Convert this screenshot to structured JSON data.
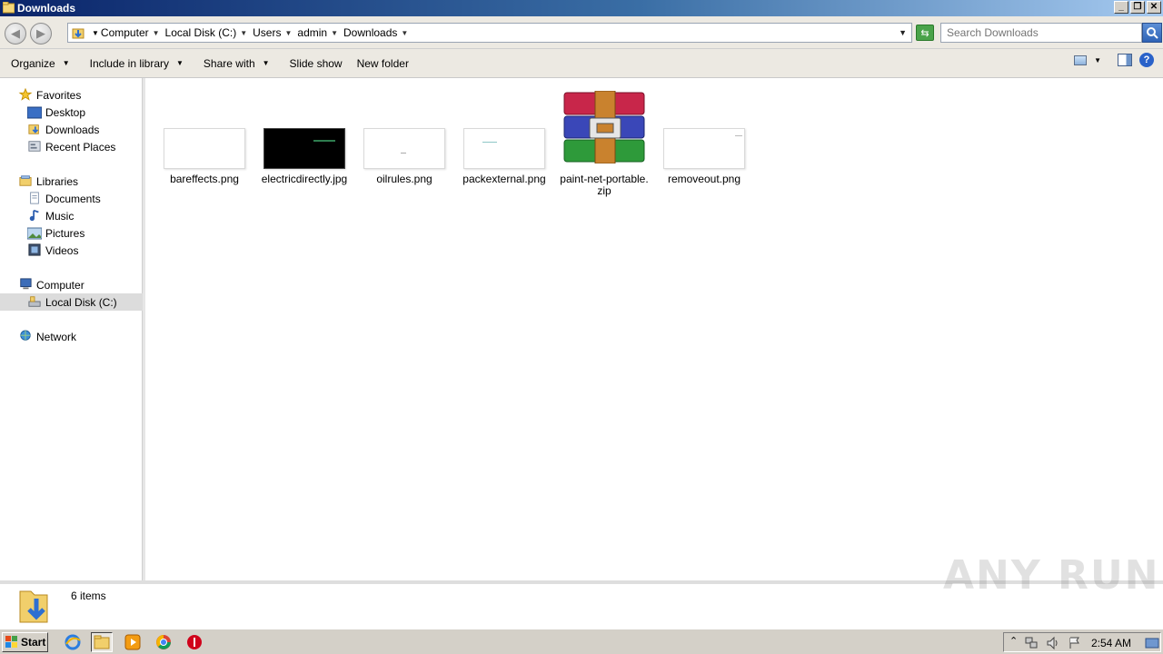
{
  "window": {
    "title": "Downloads"
  },
  "address": {
    "crumbs": [
      "Computer",
      "Local Disk (C:)",
      "Users",
      "admin",
      "Downloads"
    ],
    "search_placeholder": "Search Downloads"
  },
  "toolbar": {
    "organize": "Organize",
    "include_in_library": "Include in library",
    "share_with": "Share with",
    "slide_show": "Slide show",
    "new_folder": "New folder"
  },
  "nav": {
    "favorites": "Favorites",
    "desktop": "Desktop",
    "downloads": "Downloads",
    "recent_places": "Recent Places",
    "libraries": "Libraries",
    "documents": "Documents",
    "music": "Music",
    "pictures": "Pictures",
    "videos": "Videos",
    "computer": "Computer",
    "local_disk": "Local Disk (C:)",
    "network": "Network"
  },
  "files": [
    {
      "name": "bareffects.png",
      "kind": "image",
      "thumb": "#ffffff"
    },
    {
      "name": "electricdirectly.jpg",
      "kind": "image",
      "thumb": "#000000"
    },
    {
      "name": "oilrules.png",
      "kind": "image",
      "thumb": "#ffffff"
    },
    {
      "name": "packexternal.png",
      "kind": "image",
      "thumb": "#ffffff"
    },
    {
      "name": "paint-net-portable.\nzip",
      "kind": "archive"
    },
    {
      "name": "removeout.png",
      "kind": "image",
      "thumb": "#ffffff"
    }
  ],
  "status": {
    "item_count": "6 items"
  },
  "watermark": "ANY RUN",
  "taskbar": {
    "start": "Start",
    "clock": "2:54 AM"
  }
}
